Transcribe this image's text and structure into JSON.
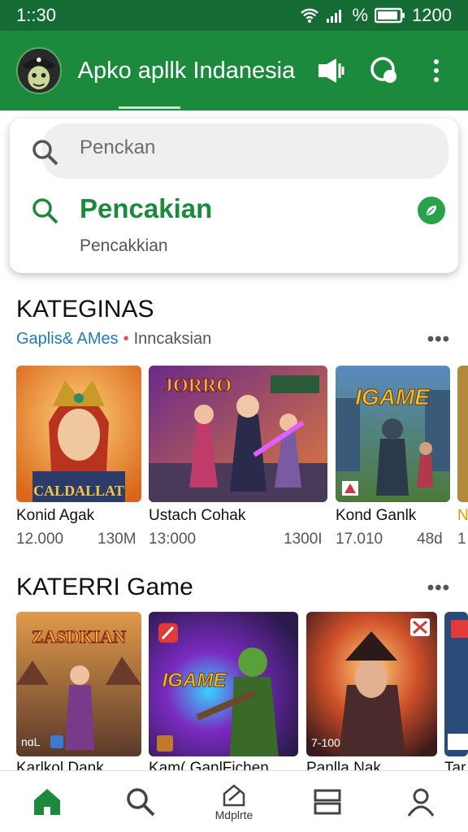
{
  "status": {
    "time": "1::30",
    "battery_text": "1200"
  },
  "app": {
    "title": "Apko apllk Indanesia"
  },
  "search": {
    "placeholder": "Penckan",
    "suggestion_title": "Pencakian",
    "suggestion_sub": "Pencakkian"
  },
  "sections": [
    {
      "title": "KATEGINAS",
      "sub_a": "Gaplis& AMes",
      "sub_b": "Inncaksian",
      "cards": [
        {
          "name": "Konid Agak",
          "meta_left": "12.000",
          "meta_right": "130M",
          "art_text": "CALDALLAT"
        },
        {
          "name": "Ustach Cohak",
          "meta_left": "13:000",
          "meta_right": "1300I",
          "art_text": "JORRO"
        },
        {
          "name": "Kond Ganlk",
          "meta_left": "17.010",
          "meta_right": "48d",
          "art_text": "IGAME"
        },
        {
          "name": "N",
          "meta_left": "1",
          "meta_right": ""
        }
      ]
    },
    {
      "title": "KATERRI Game",
      "cards": [
        {
          "name": "Karlkol Dank",
          "art_text": "ZASDKIAN",
          "badge": "nɑL"
        },
        {
          "name": "Kam( GanlFichen",
          "art_text": "IGAME"
        },
        {
          "name": "Panlla Nak",
          "badge": "7-100"
        },
        {
          "name": "Tar"
        }
      ]
    }
  ],
  "nav": [
    {
      "icon": "home-icon"
    },
    {
      "icon": "search-icon"
    },
    {
      "icon": "update-icon",
      "label": "Mdplrte"
    },
    {
      "icon": "list-icon"
    },
    {
      "icon": "profile-icon"
    }
  ]
}
